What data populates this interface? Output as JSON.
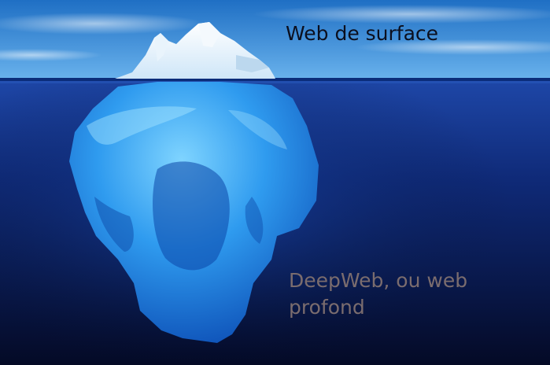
{
  "labels": {
    "surface_web": "Web de surface",
    "deep_web_line1": "DeepWeb, ou web",
    "deep_web_line2": "profond"
  },
  "colors": {
    "sky_top": "#1f74c9",
    "sky_bottom": "#5aa6e6",
    "ocean_top": "#1c3f9c",
    "ocean_bottom": "#050c2c",
    "ice_above": "#ffffff",
    "ice_below": "#3fb0ff",
    "surface_text": "#0b0f1e",
    "deep_text": "#7a6c6e"
  }
}
